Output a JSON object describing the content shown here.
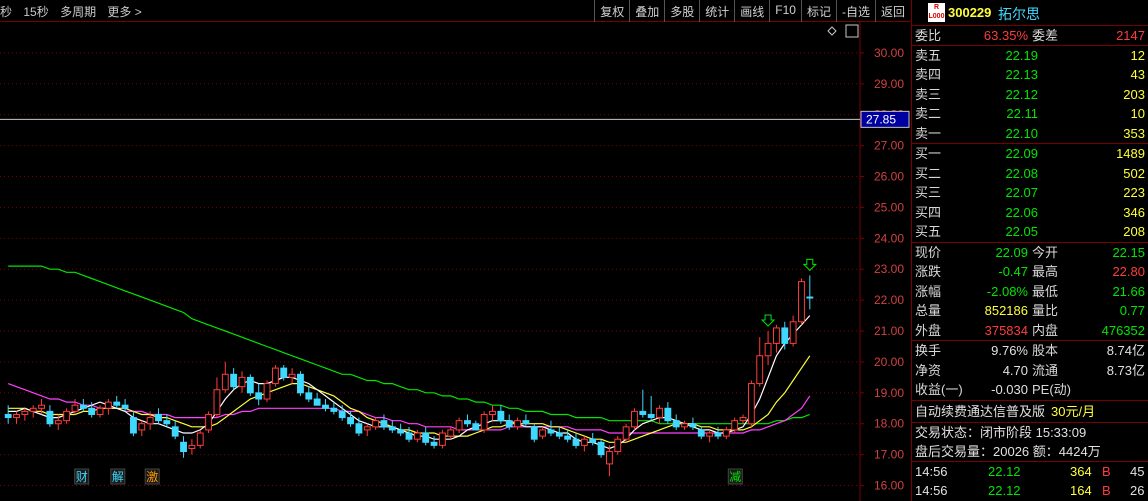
{
  "toolbar": {
    "left": [
      "秒",
      "15秒",
      "多周期",
      "更多 >"
    ],
    "right": [
      "复权",
      "叠加",
      "多股",
      "统计",
      "画线",
      "F10",
      "标记",
      "-自选",
      "返回"
    ]
  },
  "chart": {
    "price_labels": [
      "30.00",
      "29.00",
      "28.00",
      "27.00",
      "26.00",
      "25.00",
      "24.00",
      "23.00",
      "22.00",
      "21.00",
      "20.00",
      "19.00",
      "18.00",
      "17.00",
      "16.00"
    ],
    "crosshair_price": "27.85",
    "event_labels": [
      "财",
      "解",
      "激",
      "减"
    ],
    "colors": {
      "up": "#ff3c3c",
      "down": "#3fd8ff",
      "ma5": "#ffffff",
      "ma10": "#ffff3c",
      "ma20": "#ff40ff",
      "ma60": "#00e600",
      "grid": "#7a0000"
    }
  },
  "chart_data": {
    "type": "candlestick",
    "ylim": [
      15.5,
      31.0
    ],
    "candles": [
      [
        18.3,
        18.6,
        18.0,
        18.2
      ],
      [
        18.2,
        18.4,
        18.0,
        18.3
      ],
      [
        18.3,
        18.5,
        18.1,
        18.4
      ],
      [
        18.4,
        18.6,
        18.2,
        18.5
      ],
      [
        18.5,
        18.8,
        18.3,
        18.6
      ],
      [
        18.4,
        18.6,
        17.9,
        18.0
      ],
      [
        18.0,
        18.3,
        17.8,
        18.1
      ],
      [
        18.1,
        18.5,
        18.0,
        18.4
      ],
      [
        18.4,
        18.8,
        18.3,
        18.6
      ],
      [
        18.6,
        18.8,
        18.4,
        18.5
      ],
      [
        18.5,
        18.7,
        18.2,
        18.3
      ],
      [
        18.3,
        18.6,
        18.2,
        18.5
      ],
      [
        18.5,
        18.8,
        18.3,
        18.7
      ],
      [
        18.7,
        18.9,
        18.5,
        18.6
      ],
      [
        18.6,
        18.8,
        18.4,
        18.5
      ],
      [
        18.2,
        18.4,
        17.6,
        17.7
      ],
      [
        17.8,
        18.1,
        17.6,
        18.0
      ],
      [
        18.0,
        18.4,
        17.8,
        18.2
      ],
      [
        18.3,
        18.5,
        18.0,
        18.1
      ],
      [
        18.1,
        18.3,
        17.9,
        18.0
      ],
      [
        17.9,
        18.1,
        17.5,
        17.6
      ],
      [
        17.4,
        17.6,
        16.9,
        17.1
      ],
      [
        17.2,
        17.5,
        17.0,
        17.3
      ],
      [
        17.3,
        17.8,
        17.2,
        17.7
      ],
      [
        17.8,
        18.4,
        17.7,
        18.3
      ],
      [
        18.3,
        19.5,
        18.2,
        19.1
      ],
      [
        19.1,
        20.0,
        19.0,
        19.6
      ],
      [
        19.6,
        19.8,
        19.1,
        19.2
      ],
      [
        19.2,
        19.7,
        19.0,
        19.5
      ],
      [
        19.5,
        19.6,
        18.9,
        19.0
      ],
      [
        19.0,
        19.3,
        18.6,
        18.8
      ],
      [
        18.8,
        19.4,
        18.7,
        19.3
      ],
      [
        19.3,
        19.9,
        19.2,
        19.8
      ],
      [
        19.8,
        19.9,
        19.4,
        19.5
      ],
      [
        19.5,
        19.8,
        19.3,
        19.6
      ],
      [
        19.6,
        19.7,
        18.9,
        19.0
      ],
      [
        19.0,
        19.2,
        18.7,
        18.8
      ],
      [
        18.8,
        19.0,
        18.6,
        18.6
      ],
      [
        18.6,
        18.8,
        18.4,
        18.5
      ],
      [
        18.5,
        18.7,
        18.3,
        18.4
      ],
      [
        18.4,
        18.6,
        18.1,
        18.2
      ],
      [
        18.2,
        18.4,
        17.9,
        18.0
      ],
      [
        18.0,
        18.2,
        17.6,
        17.7
      ],
      [
        17.8,
        18.0,
        17.6,
        17.9
      ],
      [
        17.9,
        18.2,
        17.8,
        18.1
      ],
      [
        18.1,
        18.3,
        17.8,
        17.9
      ],
      [
        17.9,
        18.1,
        17.7,
        17.8
      ],
      [
        17.8,
        18.0,
        17.6,
        17.7
      ],
      [
        17.7,
        17.9,
        17.4,
        17.5
      ],
      [
        17.5,
        17.8,
        17.4,
        17.7
      ],
      [
        17.7,
        17.9,
        17.3,
        17.4
      ],
      [
        17.4,
        17.6,
        17.2,
        17.3
      ],
      [
        17.3,
        17.8,
        17.2,
        17.7
      ],
      [
        17.6,
        17.9,
        17.5,
        17.8
      ],
      [
        17.8,
        18.2,
        17.7,
        18.1
      ],
      [
        18.1,
        18.3,
        17.9,
        18.0
      ],
      [
        18.0,
        18.1,
        17.8,
        17.8
      ],
      [
        17.8,
        18.4,
        17.7,
        18.3
      ],
      [
        18.3,
        18.6,
        18.1,
        18.4
      ],
      [
        18.4,
        18.6,
        18.0,
        18.1
      ],
      [
        18.1,
        18.3,
        17.8,
        17.9
      ],
      [
        17.9,
        18.2,
        17.8,
        18.1
      ],
      [
        18.1,
        18.3,
        17.9,
        18.0
      ],
      [
        17.9,
        18.0,
        17.4,
        17.5
      ],
      [
        17.6,
        17.9,
        17.5,
        17.8
      ],
      [
        17.8,
        18.1,
        17.6,
        17.7
      ],
      [
        17.7,
        17.9,
        17.5,
        17.6
      ],
      [
        17.6,
        17.8,
        17.4,
        17.5
      ],
      [
        17.5,
        17.7,
        17.2,
        17.3
      ],
      [
        17.3,
        17.6,
        17.1,
        17.5
      ],
      [
        17.5,
        17.7,
        17.3,
        17.4
      ],
      [
        17.4,
        17.5,
        16.9,
        17.0
      ],
      [
        16.7,
        17.3,
        16.3,
        17.1
      ],
      [
        17.1,
        17.6,
        17.0,
        17.5
      ],
      [
        17.5,
        18.0,
        17.4,
        17.9
      ],
      [
        17.9,
        18.5,
        17.8,
        18.4
      ],
      [
        18.4,
        19.1,
        18.2,
        18.3
      ],
      [
        18.3,
        18.9,
        18.1,
        18.2
      ],
      [
        18.2,
        18.6,
        18.0,
        18.5
      ],
      [
        18.5,
        18.7,
        18.0,
        18.1
      ],
      [
        18.1,
        18.3,
        17.8,
        17.9
      ],
      [
        17.9,
        18.1,
        17.8,
        18.0
      ],
      [
        18.0,
        18.2,
        17.8,
        17.9
      ],
      [
        17.8,
        17.9,
        17.5,
        17.6
      ],
      [
        17.6,
        17.8,
        17.4,
        17.7
      ],
      [
        17.7,
        17.9,
        17.5,
        17.6
      ],
      [
        17.6,
        17.9,
        17.5,
        17.8
      ],
      [
        17.8,
        18.2,
        17.7,
        18.1
      ],
      [
        18.1,
        18.3,
        18.0,
        18.2
      ],
      [
        18.0,
        19.4,
        17.9,
        19.3
      ],
      [
        19.3,
        20.8,
        19.2,
        20.2
      ],
      [
        20.2,
        21.0,
        19.9,
        20.6
      ],
      [
        20.6,
        21.2,
        20.3,
        21.1
      ],
      [
        21.1,
        21.3,
        20.4,
        20.6
      ],
      [
        20.6,
        21.5,
        20.5,
        21.3
      ],
      [
        21.3,
        22.7,
        21.2,
        22.6
      ],
      [
        22.1,
        22.8,
        21.7,
        22.09
      ]
    ],
    "ma5": [
      18.4,
      18.4,
      18.5,
      18.4,
      18.3,
      18.2,
      18.2,
      18.3,
      18.4,
      18.5,
      18.6,
      18.7,
      18.6,
      18.5,
      18.4,
      18.2,
      18.1,
      18.0,
      18.0,
      17.9,
      17.8,
      17.7,
      17.7,
      17.8,
      18.0,
      18.4,
      18.8,
      19.1,
      19.3,
      19.4,
      19.3,
      19.3,
      19.4,
      19.5,
      19.5,
      19.4,
      19.3,
      19.1,
      18.9,
      18.7,
      18.5,
      18.3,
      18.1,
      18.0,
      17.9,
      17.9,
      17.9,
      17.8,
      17.7,
      17.6,
      17.6,
      17.5,
      17.5,
      17.5,
      17.6,
      17.8,
      17.9,
      18.0,
      18.1,
      18.1,
      18.1,
      18.0,
      17.9,
      17.9,
      17.9,
      17.8,
      17.7,
      17.7,
      17.5,
      17.4,
      17.4,
      17.3,
      17.2,
      17.3,
      17.5,
      17.8,
      18.0,
      18.1,
      18.2,
      18.2,
      18.1,
      18.0,
      17.9,
      17.8,
      17.8,
      17.7,
      17.7,
      17.8,
      17.9,
      18.3,
      18.8,
      19.5,
      20.2,
      20.6,
      20.9,
      21.2,
      21.5
    ],
    "ma10": [
      18.5,
      18.5,
      18.5,
      18.4,
      18.4,
      18.3,
      18.3,
      18.3,
      18.3,
      18.4,
      18.4,
      18.5,
      18.5,
      18.5,
      18.5,
      18.4,
      18.3,
      18.3,
      18.2,
      18.2,
      18.1,
      18.0,
      17.9,
      17.9,
      17.9,
      18.0,
      18.2,
      18.4,
      18.6,
      18.8,
      18.9,
      19.0,
      19.1,
      19.2,
      19.3,
      19.3,
      19.2,
      19.1,
      19.0,
      18.9,
      18.7,
      18.5,
      18.4,
      18.2,
      18.1,
      18.0,
      17.9,
      17.8,
      17.8,
      17.7,
      17.7,
      17.7,
      17.6,
      17.6,
      17.6,
      17.6,
      17.7,
      17.8,
      17.9,
      17.9,
      18.0,
      18.0,
      18.0,
      18.0,
      18.0,
      17.9,
      17.9,
      17.8,
      17.7,
      17.6,
      17.5,
      17.5,
      17.4,
      17.4,
      17.4,
      17.5,
      17.6,
      17.7,
      17.8,
      17.9,
      18.0,
      18.0,
      18.0,
      17.9,
      17.9,
      17.8,
      17.8,
      17.8,
      17.8,
      17.9,
      18.1,
      18.3,
      18.7,
      19.0,
      19.4,
      19.8,
      20.2
    ],
    "ma20": [
      19.3,
      19.2,
      19.1,
      19.0,
      18.9,
      18.8,
      18.8,
      18.7,
      18.7,
      18.6,
      18.6,
      18.5,
      18.5,
      18.5,
      18.4,
      18.4,
      18.4,
      18.3,
      18.3,
      18.3,
      18.2,
      18.2,
      18.2,
      18.2,
      18.2,
      18.2,
      18.3,
      18.3,
      18.4,
      18.4,
      18.5,
      18.5,
      18.5,
      18.5,
      18.5,
      18.5,
      18.5,
      18.5,
      18.5,
      18.5,
      18.4,
      18.4,
      18.4,
      18.3,
      18.2,
      18.2,
      18.1,
      18.1,
      18.0,
      18.0,
      17.9,
      17.9,
      17.9,
      17.9,
      17.8,
      17.8,
      17.8,
      17.8,
      17.8,
      17.8,
      17.9,
      17.9,
      17.9,
      17.9,
      17.9,
      17.9,
      17.9,
      17.9,
      17.8,
      17.8,
      17.8,
      17.8,
      17.7,
      17.7,
      17.7,
      17.7,
      17.7,
      17.7,
      17.7,
      17.7,
      17.7,
      17.7,
      17.7,
      17.7,
      17.7,
      17.7,
      17.7,
      17.7,
      17.7,
      17.8,
      17.8,
      17.9,
      18.0,
      18.1,
      18.3,
      18.5,
      18.9
    ],
    "ma60": [
      23.1,
      23.1,
      23.1,
      23.1,
      23.1,
      23.0,
      23.0,
      22.9,
      22.9,
      22.8,
      22.7,
      22.6,
      22.5,
      22.4,
      22.3,
      22.2,
      22.1,
      22.0,
      21.9,
      21.8,
      21.7,
      21.6,
      21.4,
      21.3,
      21.2,
      21.1,
      21.0,
      20.9,
      20.8,
      20.7,
      20.6,
      20.5,
      20.4,
      20.3,
      20.2,
      20.1,
      20.0,
      19.9,
      19.8,
      19.7,
      19.6,
      19.6,
      19.5,
      19.4,
      19.4,
      19.3,
      19.3,
      19.2,
      19.1,
      19.1,
      19.0,
      19.0,
      18.9,
      18.9,
      18.8,
      18.8,
      18.7,
      18.7,
      18.6,
      18.6,
      18.5,
      18.5,
      18.4,
      18.4,
      18.4,
      18.3,
      18.3,
      18.3,
      18.2,
      18.2,
      18.2,
      18.2,
      18.1,
      18.1,
      18.1,
      18.1,
      18.1,
      18.1,
      18.0,
      18.0,
      18.0,
      18.0,
      18.0,
      18.0,
      18.0,
      18.0,
      18.0,
      18.0,
      18.0,
      18.0,
      18.0,
      18.0,
      18.1,
      18.1,
      18.2,
      18.2,
      18.3
    ]
  },
  "panel": {
    "logo_top": "R",
    "logo_bottom": "L000",
    "code": "300229",
    "name": "拓尔思",
    "weibi": {
      "label": "委比",
      "value": "63.35%",
      "label2": "委差",
      "value2": "2147"
    },
    "asks": [
      {
        "label": "卖五",
        "price": "22.19",
        "vol": "12"
      },
      {
        "label": "卖四",
        "price": "22.13",
        "vol": "43"
      },
      {
        "label": "卖三",
        "price": "22.12",
        "vol": "203"
      },
      {
        "label": "卖二",
        "price": "22.11",
        "vol": "10"
      },
      {
        "label": "卖一",
        "price": "22.10",
        "vol": "353"
      }
    ],
    "bids": [
      {
        "label": "买一",
        "price": "22.09",
        "vol": "1489"
      },
      {
        "label": "买二",
        "price": "22.08",
        "vol": "502"
      },
      {
        "label": "买三",
        "price": "22.07",
        "vol": "223"
      },
      {
        "label": "买四",
        "price": "22.06",
        "vol": "346"
      },
      {
        "label": "买五",
        "price": "22.05",
        "vol": "208"
      }
    ],
    "quote": [
      {
        "l1": "现价",
        "v1": "22.09",
        "c1": "green",
        "l2": "今开",
        "v2": "22.15",
        "c2": "green"
      },
      {
        "l1": "涨跌",
        "v1": "-0.47",
        "c1": "green",
        "l2": "最高",
        "v2": "22.80",
        "c2": "red"
      },
      {
        "l1": "涨幅",
        "v1": "-2.08%",
        "c1": "green",
        "l2": "最低",
        "v2": "21.66",
        "c2": "green"
      },
      {
        "l1": "总量",
        "v1": "852186",
        "c1": "yellow",
        "l2": "量比",
        "v2": "0.77",
        "c2": "green"
      },
      {
        "l1": "外盘",
        "v1": "375834",
        "c1": "red",
        "l2": "内盘",
        "v2": "476352",
        "c2": "green"
      }
    ],
    "fund": [
      {
        "l1": "换手",
        "v1": "9.76%",
        "l2": "股本",
        "v2": "8.74亿"
      },
      {
        "l1": "净资",
        "v1": "4.70",
        "l2": "流通",
        "v2": "8.73亿"
      },
      {
        "l1": "收益(一)",
        "v1": "-0.030",
        "l2": "PE(动)",
        "v2": ""
      }
    ],
    "banner_text": "自动续费通达信普及版",
    "banner_price": "30元/月",
    "trade_status": "交易状态：闭市阶段 15:33:09",
    "after_hours": "盘后交易量：20026 额：4424万",
    "ticks": [
      {
        "time": "14:56",
        "price": "22.12",
        "vol": "364",
        "bs": "B",
        "n": "45"
      },
      {
        "time": "14:56",
        "price": "22.12",
        "vol": "164",
        "bs": "B",
        "n": "26"
      }
    ]
  }
}
